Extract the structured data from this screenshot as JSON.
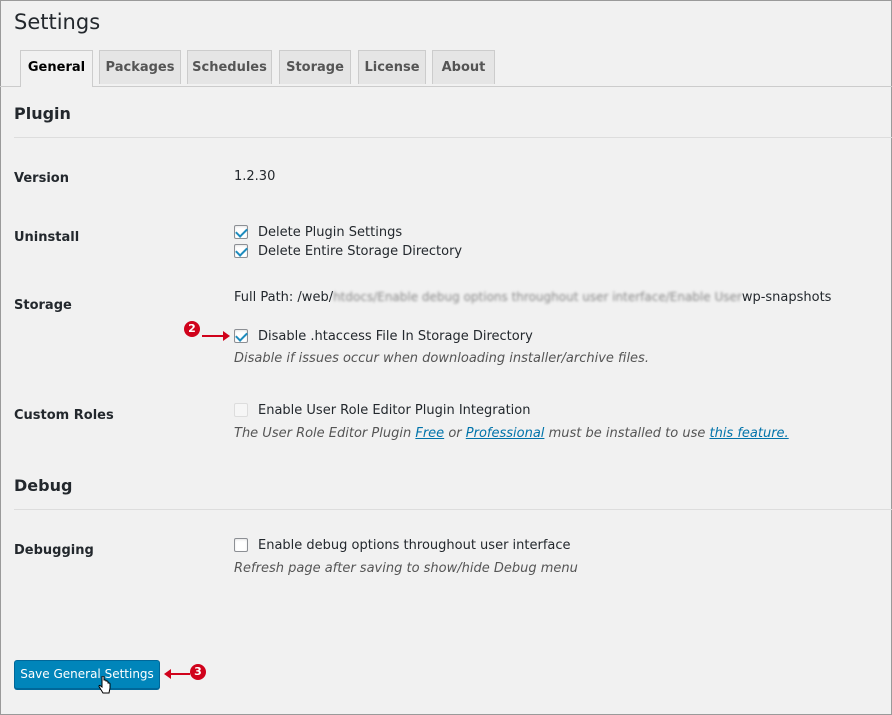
{
  "page": {
    "title": "Settings"
  },
  "tabs": [
    {
      "label": "General",
      "active": true
    },
    {
      "label": "Packages",
      "active": false
    },
    {
      "label": "Schedules",
      "active": false
    },
    {
      "label": "Storage",
      "active": false
    },
    {
      "label": "License",
      "active": false
    },
    {
      "label": "About",
      "active": false
    }
  ],
  "plugin": {
    "heading": "Plugin",
    "version": {
      "label": "Version",
      "value": "1.2.30"
    },
    "uninstall": {
      "label": "Uninstall",
      "options": [
        {
          "label": "Delete Plugin Settings",
          "checked": true
        },
        {
          "label": "Delete Entire Storage Directory",
          "checked": true
        }
      ]
    },
    "storage": {
      "label": "Storage",
      "full_path_label": "Full Path: /web/",
      "full_path_blurred": "htdocs/Enable debug options throughout user interface/Enable User",
      "full_path_suffix": "wp-snapshots",
      "htaccess": {
        "label": "Disable .htaccess File In Storage Directory",
        "checked": true
      },
      "htaccess_desc": "Disable if issues occur when downloading installer/archive files."
    },
    "custom_roles": {
      "label": "Custom Roles",
      "option": {
        "label": "Enable User Role Editor Plugin Integration",
        "checked": false,
        "disabled": true
      },
      "desc_prefix": "The User Role Editor Plugin",
      "link_free": "Free",
      "desc_or": "or",
      "link_professional": "Professional",
      "desc_middle": "must be installed to use",
      "link_feature": "this feature."
    }
  },
  "debug": {
    "heading": "Debug",
    "debugging": {
      "label": "Debugging",
      "option": {
        "label": "Enable debug options throughout user interface",
        "checked": false
      },
      "desc": "Refresh page after saving to show/hide Debug menu"
    }
  },
  "save_button": {
    "label": "Save General Settings"
  },
  "annotations": {
    "step2": "2",
    "step3": "3",
    "color": "#d0021b"
  },
  "colors": {
    "primary_button": "#0085ba",
    "link": "#0073aa",
    "checkmark": "#1e8cbe"
  },
  "icons": {
    "cursor": "hand-pointer-icon"
  }
}
